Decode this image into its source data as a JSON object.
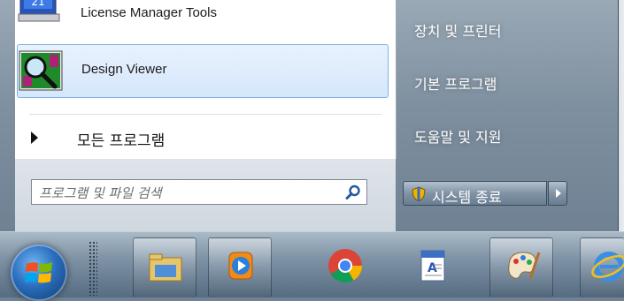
{
  "programs": [
    {
      "label": "License Manager Tools",
      "icon": "license-manager-icon"
    },
    {
      "label": "Design Viewer",
      "icon": "design-viewer-icon",
      "highlighted": true
    }
  ],
  "all_programs": {
    "label": "모든 프로그램"
  },
  "search": {
    "placeholder": "프로그램 및 파일 검색",
    "value": "",
    "icon": "search-icon"
  },
  "right_menu": {
    "items": [
      "장치 및 프린터",
      "기본 프로그램",
      "도움말 및 지원"
    ]
  },
  "shutdown": {
    "label": "시스템 종료",
    "icon": "shield-icon"
  },
  "taskbar": {
    "items": [
      {
        "name": "start-orb",
        "icon": "windows-logo-icon"
      },
      {
        "name": "file-explorer",
        "icon": "folder-icon"
      },
      {
        "name": "media-player",
        "icon": "media-player-icon"
      },
      {
        "name": "chrome",
        "icon": "chrome-icon"
      },
      {
        "name": "wordpad",
        "icon": "wordpad-icon"
      },
      {
        "name": "paint",
        "icon": "paint-icon"
      },
      {
        "name": "internet-explorer",
        "icon": "ie-icon"
      }
    ]
  },
  "colors": {
    "highlight": "#d5e7fb",
    "highlight_border": "#7fb2e4",
    "taskbar": "#7f93a6"
  }
}
